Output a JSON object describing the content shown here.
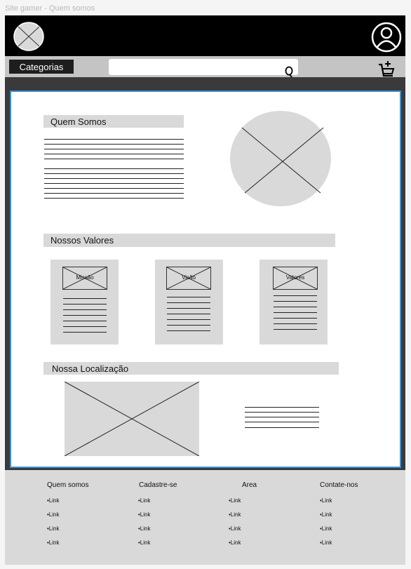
{
  "window": {
    "title": "Site gamer - Quem somos"
  },
  "header": {
    "logo_icon": "image-placeholder-icon",
    "user_icon": "user-icon"
  },
  "nav": {
    "categories_label": "Categorias",
    "search_placeholder": "",
    "search_icon": "search-icon",
    "cart_icon": "cart-add-icon"
  },
  "about": {
    "heading": "Quem Somos",
    "image_icon": "image-placeholder-icon"
  },
  "values": {
    "heading": "Nossos Valores",
    "cards": [
      {
        "label": "Missão"
      },
      {
        "label": "Visão"
      },
      {
        "label": "Valores"
      }
    ]
  },
  "location": {
    "heading": "Nossa Localização",
    "map_icon": "image-placeholder-icon"
  },
  "footer": {
    "columns": [
      {
        "title": "Quem somos",
        "links": [
          "•Link",
          "•Link",
          "•Link",
          "•Link"
        ]
      },
      {
        "title": "Cadastre-se",
        "links": [
          "•Link",
          "•Link",
          "•Link",
          "•Link"
        ]
      },
      {
        "title": "Area",
        "links": [
          "•Link",
          "•Link",
          "•Link",
          "•Link"
        ]
      },
      {
        "title": "Contate-nos",
        "links": [
          "•Link",
          "•Link",
          "•Link",
          "•Link"
        ]
      }
    ]
  },
  "colors": {
    "accent_border": "#2196f3",
    "placeholder_gray": "#d9d9d9",
    "header_black": "#000000"
  }
}
